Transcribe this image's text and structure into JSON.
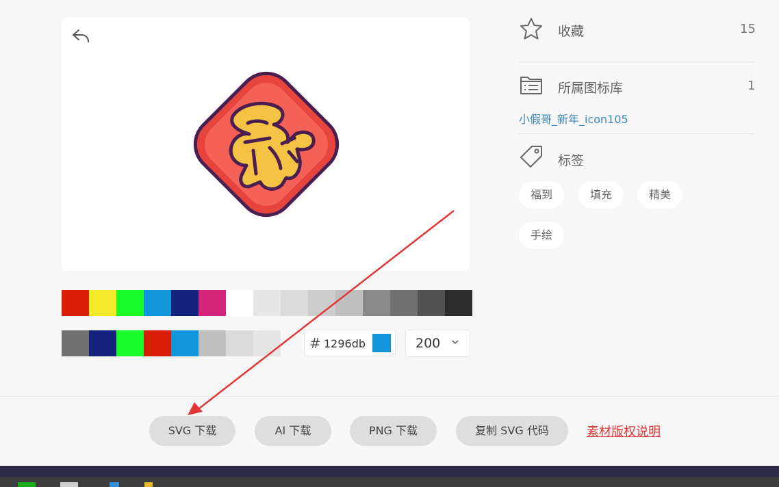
{
  "favorites": {
    "label": "收藏",
    "count": "15"
  },
  "library": {
    "label": "所属图标库",
    "count": "1",
    "link": "小假哥_新年_icon105"
  },
  "tags": {
    "label": "标签",
    "items": [
      "福到",
      "填充",
      "精美",
      "手绘"
    ]
  },
  "palette": {
    "row1": [
      "#d81e06",
      "#f4ea2a",
      "#1afa29",
      "#1296db",
      "#13227a",
      "#d4237a",
      "#ffffff",
      "#e6e6e6",
      "#dbdbdb",
      "#cdcdcd",
      "#bfbfbf",
      "#8a8a8a",
      "#707070",
      "#515151",
      "#2c2c2c"
    ],
    "row2": [
      "#707070",
      "#13227a",
      "#1afa29",
      "#d81e06",
      "#1296db",
      "#bfbfbf",
      "#dbdbdb",
      "#e6e6e6"
    ]
  },
  "color_input": {
    "hash": "#",
    "value": "1296db",
    "preview_color": "#1296db"
  },
  "size_select": {
    "value": "200"
  },
  "buttons": {
    "svg": "SVG 下载",
    "ai": "AI 下载",
    "png": "PNG 下载",
    "copy_svg": "复制 SVG 代码",
    "license": "素材版权说明"
  },
  "colors": {
    "accent_link": "#3a87b9",
    "license_red": "#e23636",
    "arrow_red": "#e23636"
  },
  "icons": [
    "undo-icon",
    "star-icon",
    "folder-icon",
    "tag-icon",
    "chevron-down-icon",
    "fu-icon"
  ]
}
